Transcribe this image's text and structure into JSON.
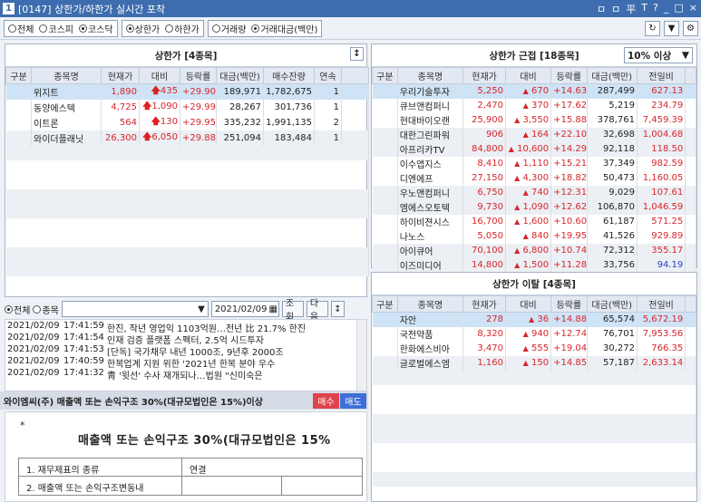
{
  "window": {
    "number": "1",
    "title": "[0147] 상한가/하한가 실시간 포착",
    "controls": [
      "ㅁ",
      "ㅁ",
      "平",
      "T",
      "?",
      "_",
      "□",
      "×"
    ]
  },
  "toolbar": {
    "market": [
      "전체",
      "코스피",
      "코스닥"
    ],
    "limit": [
      "상한가",
      "하한가"
    ],
    "sort": [
      "거래량",
      "거래대금(백만)"
    ]
  },
  "upper": {
    "title": "상한가 [4종목]",
    "columns": [
      "구분",
      "종목명",
      "현재가",
      "대비",
      "등락률",
      "대금(백만)",
      "매수잔량",
      "연속"
    ],
    "rows": [
      {
        "name": "위지트",
        "price": "1,890",
        "diff": "435",
        "rate": "+29.90",
        "amount": "189,971",
        "bid": "1,782,675",
        "streak": "1"
      },
      {
        "name": "동양에스텍",
        "price": "4,725",
        "diff": "1,090",
        "rate": "+29.99",
        "amount": "28,267",
        "bid": "301,736",
        "streak": "1"
      },
      {
        "name": "이트론",
        "price": "564",
        "diff": "130",
        "rate": "+29.95",
        "amount": "335,232",
        "bid": "1,991,135",
        "streak": "2"
      },
      {
        "name": "와이더플래닛",
        "price": "26,300",
        "diff": "6,050",
        "rate": "+29.88",
        "amount": "251,094",
        "bid": "183,484",
        "streak": "1"
      }
    ]
  },
  "near": {
    "title": "상한가 근접 [18종목]",
    "filter": "10% 이상",
    "columns": [
      "구분",
      "종목명",
      "현재가",
      "대비",
      "등락률",
      "대금(백만)",
      "전일비"
    ],
    "rows": [
      {
        "name": "우리기술투자",
        "price": "5,250",
        "diff": "670",
        "rate": "+14.63",
        "amount": "287,499",
        "prev": "627.13"
      },
      {
        "name": "큐브앤컴퍼니",
        "price": "2,470",
        "diff": "370",
        "rate": "+17.62",
        "amount": "5,219",
        "prev": "234.79"
      },
      {
        "name": "현대바이오랜",
        "price": "25,900",
        "diff": "3,550",
        "rate": "+15.88",
        "amount": "378,761",
        "prev": "7,459.39"
      },
      {
        "name": "대한그린파워",
        "price": "906",
        "diff": "164",
        "rate": "+22.10",
        "amount": "32,698",
        "prev": "1,004.68"
      },
      {
        "name": "아프리카TV",
        "price": "84,800",
        "diff": "10,600",
        "rate": "+14.29",
        "amount": "92,118",
        "prev": "118.50"
      },
      {
        "name": "이수앱지스",
        "price": "8,410",
        "diff": "1,110",
        "rate": "+15.21",
        "amount": "37,349",
        "prev": "982.59"
      },
      {
        "name": "디엔에프",
        "price": "27,150",
        "diff": "4,300",
        "rate": "+18.82",
        "amount": "50,473",
        "prev": "1,160.05"
      },
      {
        "name": "우노앤컴퍼니",
        "price": "6,750",
        "diff": "740",
        "rate": "+12.31",
        "amount": "9,029",
        "prev": "107.61"
      },
      {
        "name": "엠에스오토텍",
        "price": "9,730",
        "diff": "1,090",
        "rate": "+12.62",
        "amount": "106,870",
        "prev": "1,046.59"
      },
      {
        "name": "하이비젼시스",
        "price": "16,700",
        "diff": "1,600",
        "rate": "+10.60",
        "amount": "61,187",
        "prev": "571.25"
      },
      {
        "name": "나노스",
        "price": "5,050",
        "diff": "840",
        "rate": "+19.95",
        "amount": "41,526",
        "prev": "929.89"
      },
      {
        "name": "아이큐어",
        "price": "70,100",
        "diff": "6,800",
        "rate": "+10.74",
        "amount": "72,312",
        "prev": "355.17"
      },
      {
        "name": "이즈미디어",
        "price": "14,800",
        "diff": "1,500",
        "rate": "+11.28",
        "amount": "33,756",
        "prev": "94.19"
      }
    ]
  },
  "leave": {
    "title": "상한가 이탈 [4종목]",
    "columns": [
      "구분",
      "종목명",
      "현재가",
      "대비",
      "등락률",
      "대금(백만)",
      "전일비"
    ],
    "rows": [
      {
        "name": "자안",
        "price": "278",
        "diff": "36",
        "rate": "+14.88",
        "amount": "65,574",
        "prev": "5,672.19"
      },
      {
        "name": "국전약품",
        "price": "8,320",
        "diff": "940",
        "rate": "+12.74",
        "amount": "76,701",
        "prev": "7,953.56"
      },
      {
        "name": "한화에스비아",
        "price": "3,470",
        "diff": "555",
        "rate": "+19.04",
        "amount": "30,272",
        "prev": "766.35"
      },
      {
        "name": "글로벌에스엠",
        "price": "1,160",
        "diff": "150",
        "rate": "+14.85",
        "amount": "57,187",
        "prev": "2,633.14"
      }
    ]
  },
  "news": {
    "scope": [
      "전체",
      "종목"
    ],
    "date": "2021/02/09",
    "query_label": "조회",
    "next_label": "다음",
    "items": [
      {
        "date": "2021/02/09",
        "time": "17:41:59",
        "text": "한진, 작년 영업익 1103억원…전년 比 21.7% 한진"
      },
      {
        "date": "2021/02/09",
        "time": "17:41:54",
        "text": "인재 검증 플랫폼 스펙터, 2.5억 시드투자"
      },
      {
        "date": "2021/02/09",
        "time": "17:41:53",
        "text": "[단독] 국가채무 내년 1000조, 9년후 2000조"
      },
      {
        "date": "2021/02/09",
        "time": "17:40:59",
        "text": "한복업계 지원 위한 '2021년 한복 분야 우수"
      },
      {
        "date": "2021/02/09",
        "time": "17:41:32",
        "text": "靑 '윗선' 수사 재개되나…법원 \"신미숙은"
      }
    ],
    "notice": "와이엠씨(주) 매출액 또는 손익구조 30%(대규모법인은 15%)이상",
    "buy": "매수",
    "sell": "매도"
  },
  "doc": {
    "star": "*",
    "heading": "매출액 또는 손익구조 30%(대규모법인은 15%",
    "row1a": "1. 재무제표의 종류",
    "row1b": "연결",
    "row2": "2. 매출액 또는 손익구조변동내"
  },
  "colors": {
    "up": "#d8262b",
    "title": "#3d6dae",
    "blue": "#1d45c8"
  }
}
